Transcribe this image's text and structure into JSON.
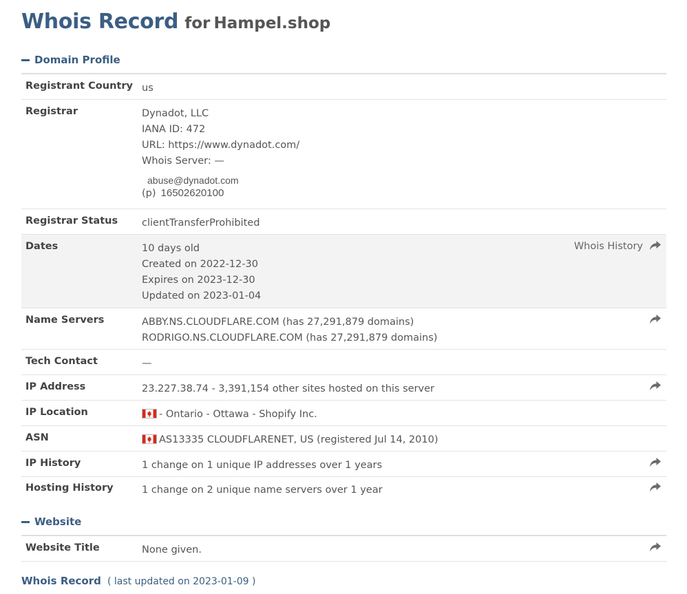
{
  "header": {
    "title": "Whois Record",
    "for_word": "for",
    "domain": "Hampel.shop"
  },
  "domain_profile": {
    "heading": "Domain Profile",
    "registrant_country": {
      "label": "Registrant Country",
      "value": "us"
    },
    "registrar": {
      "label": "Registrar",
      "name": "Dynadot, LLC",
      "iana": "IANA ID: 472",
      "url": "URL: https://www.dynadot.com/",
      "whois_server": "Whois Server: —",
      "email": "abuse@dynadot.com",
      "phone_prefix": "(p)",
      "phone": "16502620100"
    },
    "registrar_status": {
      "label": "Registrar Status",
      "value": "clientTransferProhibited"
    },
    "dates": {
      "label": "Dates",
      "age": "10 days old",
      "created": "Created on 2022-12-30",
      "expires": "Expires on 2023-12-30",
      "updated": "Updated on 2023-01-04",
      "history_link": "Whois History"
    },
    "name_servers": {
      "label": "Name Servers",
      "ns1": "ABBY.NS.CLOUDFLARE.COM (has 27,291,879 domains)",
      "ns2": "RODRIGO.NS.CLOUDFLARE.COM (has 27,291,879 domains)"
    },
    "tech_contact": {
      "label": "Tech Contact",
      "value": "—"
    },
    "ip_address": {
      "label": "IP Address",
      "value": "23.227.38.74 - 3,391,154 other sites hosted on this server"
    },
    "ip_location": {
      "label": "IP Location",
      "value": "- Ontario - Ottawa - Shopify Inc."
    },
    "asn": {
      "label": "ASN",
      "value": "AS13335 CLOUDFLARENET, US (registered Jul 14, 2010)"
    },
    "ip_history": {
      "label": "IP History",
      "value": "1 change on 1 unique IP addresses over 1 years"
    },
    "hosting_history": {
      "label": "Hosting History",
      "value": "1 change on 2 unique name servers over 1 year"
    }
  },
  "website": {
    "heading": "Website",
    "title": {
      "label": "Website Title",
      "value": "None given."
    }
  },
  "footer": {
    "title": "Whois Record",
    "updated": "( last updated on 2023-01-09 )"
  },
  "icons": {
    "share": "share-arrow-icon",
    "collapse": "minus-icon",
    "flag": "canada-flag-icon"
  },
  "colors": {
    "accent": "#3b5e83",
    "row_shade": "#f3f3f3",
    "flag_red": "#d52b1e"
  }
}
